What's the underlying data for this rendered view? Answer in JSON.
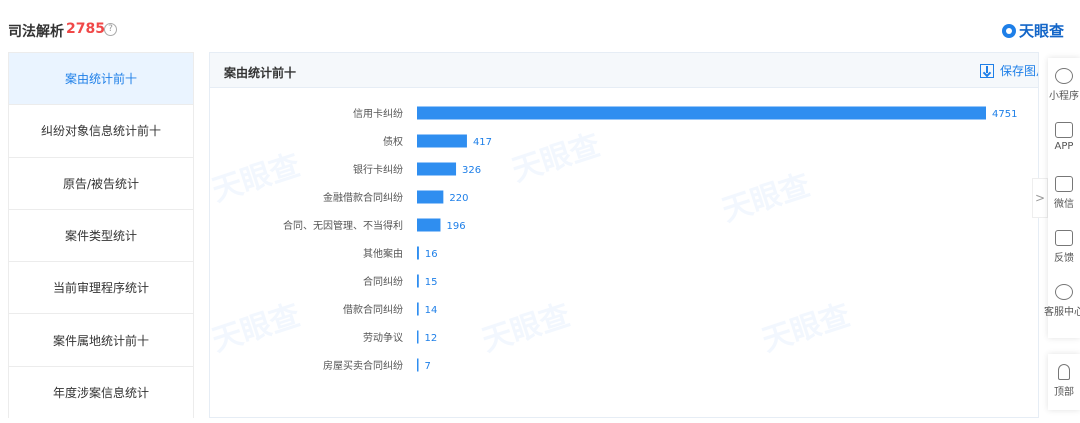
{
  "header": {
    "title": "司法解析",
    "count": "2785",
    "help_icon": "?",
    "brand": "天眼查"
  },
  "sidebar": {
    "items": [
      {
        "label": "案由统计前十",
        "active": true
      },
      {
        "label": "纠纷对象信息统计前十",
        "active": false
      },
      {
        "label": "原告/被告统计",
        "active": false
      },
      {
        "label": "案件类型统计",
        "active": false
      },
      {
        "label": "当前审理程序统计",
        "active": false
      },
      {
        "label": "案件属地统计前十",
        "active": false
      },
      {
        "label": "年度涉案信息统计",
        "active": false
      }
    ]
  },
  "panel": {
    "title": "案由统计前十",
    "save_label": "保存图片",
    "watermark": "天眼查"
  },
  "chart_data": {
    "type": "bar",
    "orientation": "horizontal",
    "categories": [
      "信用卡纠纷",
      "债权",
      "银行卡纠纷",
      "金融借款合同纠纷",
      "合同、无因管理、不当得利",
      "其他案由",
      "合同纠纷",
      "借款合同纠纷",
      "劳动争议",
      "房屋买卖合同纠纷"
    ],
    "values": [
      4751,
      417,
      326,
      220,
      196,
      16,
      15,
      14,
      12,
      7
    ],
    "value_labels": [
      "4751",
      "417",
      "326",
      "220",
      "196",
      "16",
      "15",
      "14",
      "12",
      "7"
    ],
    "bar_color": "#2f8ef0",
    "label_color": "#1e7fe8",
    "xlim": [
      0,
      4751
    ]
  },
  "float_bar": {
    "items": [
      {
        "label": "小程序",
        "icon": "mini-program-icon"
      },
      {
        "label": "APP",
        "icon": "phone-icon"
      },
      {
        "label": "微信",
        "icon": "qrcode-icon"
      },
      {
        "label": "反馈",
        "icon": "feedback-icon"
      },
      {
        "label": "客服中心",
        "icon": "service-icon"
      }
    ],
    "top_label": "顶部",
    "collapse": ">"
  }
}
